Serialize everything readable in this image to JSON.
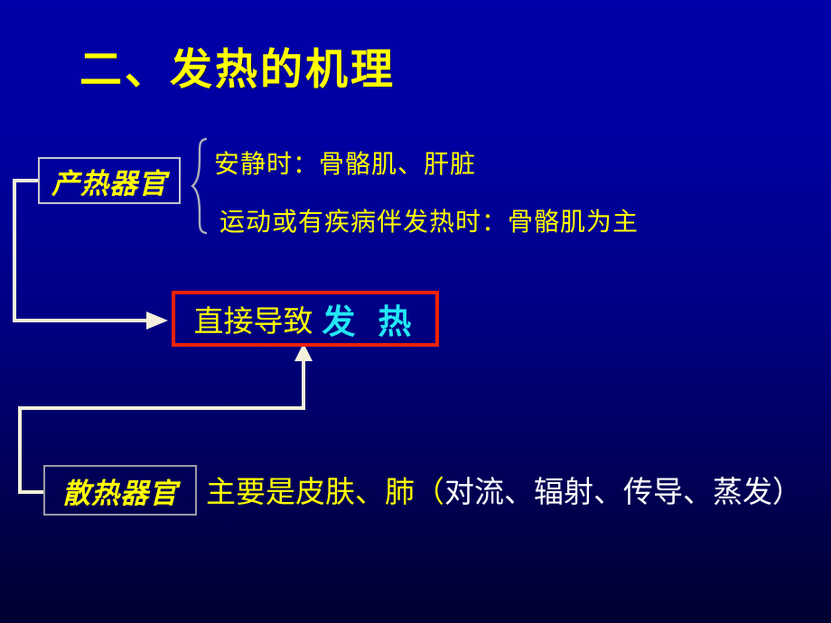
{
  "slide": {
    "title": "二、发热的机理",
    "background": {
      "top_color": "#0000a8",
      "bottom_color": "#000030"
    }
  },
  "colors": {
    "title_yellow": "#ffff00",
    "accent_cyan": "#22e8f5",
    "result_box_red": "#ee2200",
    "label_box_border": "#c7c7cf",
    "connector_cream": "#f3f0dc",
    "white_text": "#ffffff"
  },
  "nodes": {
    "heat_production": {
      "label": "产热器官",
      "details": [
        "安静时：骨骼肌、肝脏",
        "运动或有疾病伴发热时：骨骼肌为主"
      ]
    },
    "fever_result": {
      "lead": "直接导致",
      "accent": "发 热"
    },
    "heat_dissipation": {
      "label": "散热器官",
      "description_yellow": "主要是皮肤、肺（",
      "description_white": "对流、辐射、传导、蒸发）"
    }
  },
  "connectors": [
    {
      "name": "production-to-fever",
      "from": "heat_production",
      "to": "fever_result",
      "arrow": "right"
    },
    {
      "name": "dissipation-to-fever",
      "from": "heat_dissipation",
      "to": "fever_result",
      "arrow": "up"
    }
  ]
}
